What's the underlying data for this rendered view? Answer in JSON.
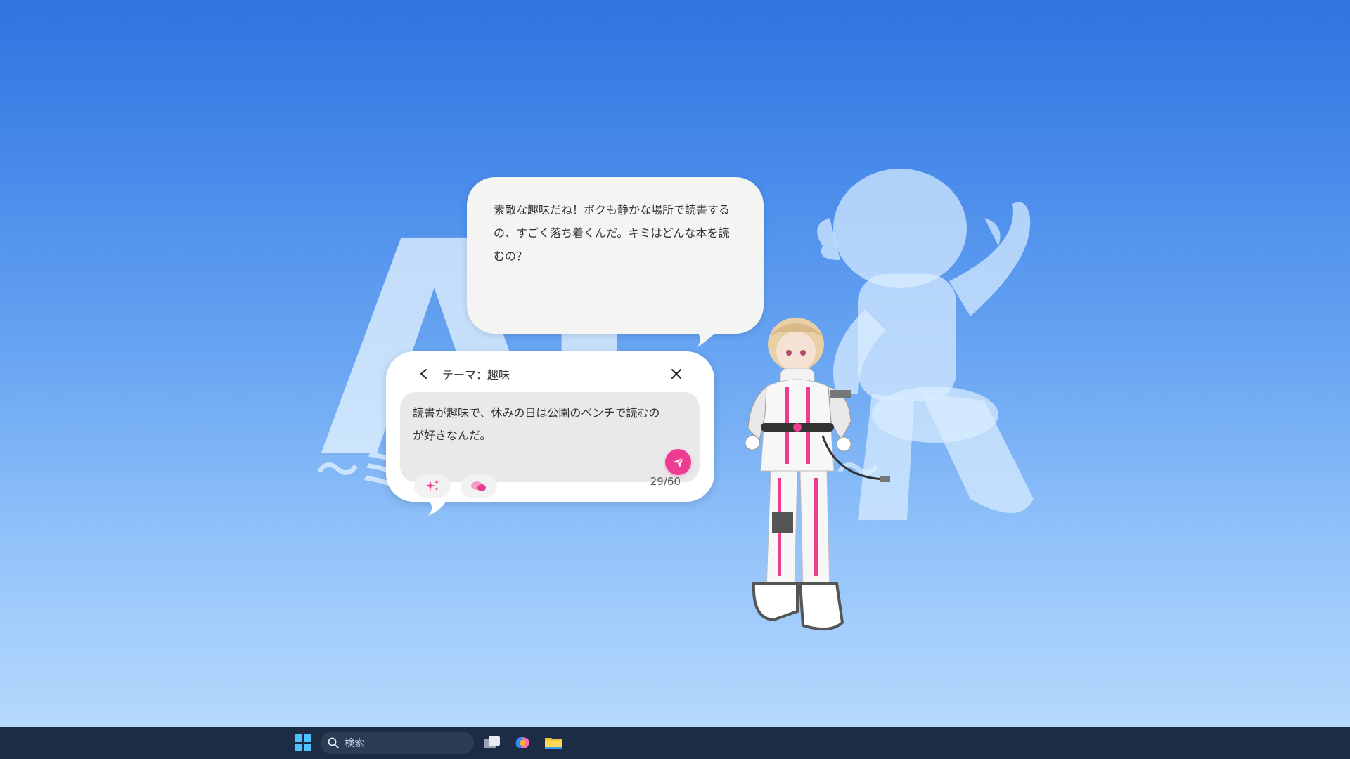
{
  "watermark": {
    "main_text": "AI",
    "sub_left": "〜ミ",
    "sub_right": "ケ〜"
  },
  "assistant_bubble": {
    "text": "素敵な趣味だね！ボクも静かな場所で読書するの、すごく落ち着くんだ。キミはどんな本を読むの？"
  },
  "input_panel": {
    "title": "テーマ：趣味",
    "input_text": "読書が趣味で、休みの日は公園のベンチで読むのが好きなんだ。",
    "counter": "29/60",
    "send_icon": "paper-plane-icon",
    "chip_icons": [
      "sparkle-icon",
      "chat-bubbles-icon"
    ],
    "accent_color": "#ef3c93"
  },
  "taskbar": {
    "search_placeholder": "検索",
    "icons": [
      "windows-start-icon",
      "task-view-icon",
      "copilot-icon",
      "file-explorer-icon"
    ]
  }
}
